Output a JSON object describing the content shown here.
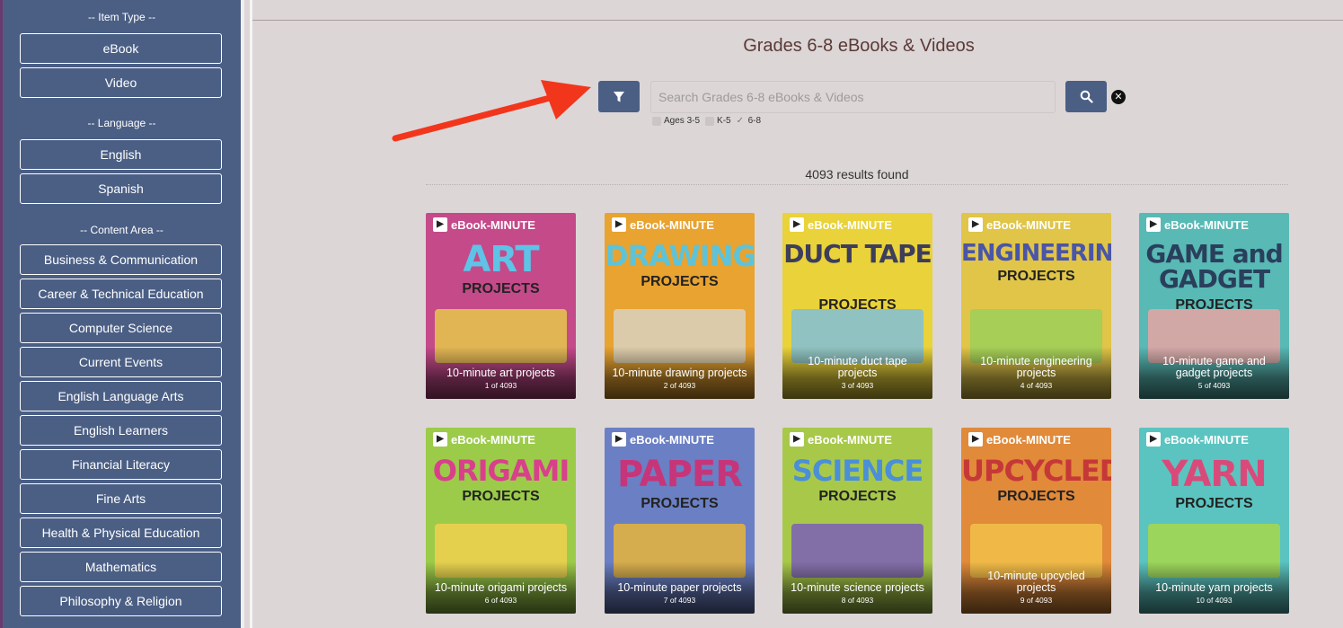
{
  "sidebar": {
    "item_type": {
      "title": "-- Item Type --",
      "options": [
        "eBook",
        "Video"
      ]
    },
    "language": {
      "title": "-- Language --",
      "options": [
        "English",
        "Spanish"
      ]
    },
    "content_area": {
      "title": "-- Content Area --",
      "options": [
        "Business & Communication",
        "Career & Technical Education",
        "Computer Science",
        "Current Events",
        "English Language Arts",
        "English Learners",
        "Financial Literacy",
        "Fine Arts",
        "Health & Physical Education",
        "Mathematics",
        "Philosophy & Religion"
      ]
    }
  },
  "main": {
    "title": "Grades 6-8 eBooks & Videos",
    "search": {
      "placeholder": "Search Grades 6-8 eBooks & Videos",
      "value": ""
    },
    "grade_filters": [
      {
        "label": "Ages 3-5",
        "checked": false
      },
      {
        "label": "K-5",
        "checked": false
      },
      {
        "label": "6-8",
        "checked": true
      }
    ],
    "results_text": "4093 results found"
  },
  "books": [
    {
      "title": "10-minute art projects",
      "count": "1 of 4093",
      "cover_word": "ART",
      "cover_sub": "PROJECTS",
      "header": "eBook-MINUTE",
      "bg": "#c44a8a",
      "word_color": "#5ec3e6",
      "art_color": "#e6c84a"
    },
    {
      "title": "10-minute drawing projects",
      "count": "2 of 4093",
      "cover_word": "DRAWING",
      "cover_sub": "PROJECTS",
      "header": "eBook-MINUTE",
      "bg": "#e8a330",
      "word_color": "#5ec3d8",
      "art_color": "#d9d2c0"
    },
    {
      "title": "10-minute duct tape projects",
      "count": "3 of 4093",
      "cover_word": "DUCT TAPE",
      "cover_sub": "PROJECTS",
      "header": "eBook-MINUTE",
      "bg": "#e9d23a",
      "word_color": "#3d3d5c",
      "art_color": "#7fbfd8"
    },
    {
      "title": "10-minute engineering projects",
      "count": "4 of 4093",
      "cover_word": "ENGINEERING",
      "cover_sub": "PROJECTS",
      "header": "eBook-MINUTE",
      "bg": "#e0c548",
      "word_color": "#4a55a8",
      "art_color": "#9ccf5a"
    },
    {
      "title": "10-minute game and gadget projects",
      "count": "5 of 4093",
      "cover_word": "GAME and GADGET",
      "cover_sub": "PROJECTS",
      "header": "eBook-MINUTE",
      "bg": "#58b9b5",
      "word_color": "#2a3f5c",
      "art_color": "#e8a4a4"
    },
    {
      "title": "10-minute origami projects",
      "count": "6 of 4093",
      "cover_word": "ORIGAMI",
      "cover_sub": "PROJECTS",
      "header": "eBook-MINUTE",
      "bg": "#9ccb4a",
      "word_color": "#d9408c",
      "art_color": "#f2d14f"
    },
    {
      "title": "10-minute paper projects",
      "count": "7 of 4093",
      "cover_word": "PAPER",
      "cover_sub": "PROJECTS",
      "header": "eBook-MINUTE",
      "bg": "#6b7fc4",
      "word_color": "#c6357a",
      "art_color": "#e8b43a"
    },
    {
      "title": "10-minute science projects",
      "count": "8 of 4093",
      "cover_word": "SCIENCE",
      "cover_sub": "PROJECTS",
      "header": "eBook-MINUTE",
      "bg": "#a8c84a",
      "word_color": "#4a8fd8",
      "art_color": "#7c5fb8"
    },
    {
      "title": "10-minute upcycled projects",
      "count": "9 of 4093",
      "cover_word": "UPCYCLED",
      "cover_sub": "PROJECTS",
      "header": "eBook-MINUTE",
      "bg": "#e08a3a",
      "word_color": "#c63838",
      "art_color": "#f2c14a"
    },
    {
      "title": "10-minute yarn projects",
      "count": "10 of 4093",
      "cover_word": "YARN",
      "cover_sub": "PROJECTS",
      "header": "eBook-MINUTE",
      "bg": "#5bc4c0",
      "word_color": "#d94a7a",
      "art_color": "#a8d84a"
    }
  ]
}
